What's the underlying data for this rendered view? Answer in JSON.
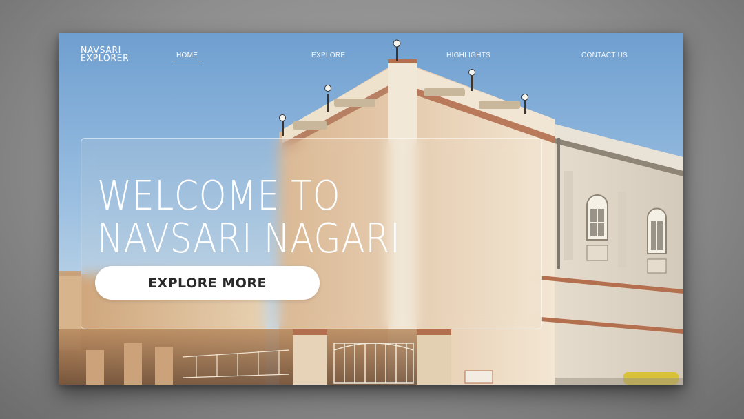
{
  "brand": {
    "line1": "NAVSARI",
    "line2": "EXPLORER"
  },
  "nav": {
    "items": [
      {
        "label": "HOME",
        "active": true
      },
      {
        "label": "EXPLORE",
        "active": false
      },
      {
        "label": "HIGHLIGHTS",
        "active": false
      },
      {
        "label": "CONTACT US",
        "active": false
      }
    ]
  },
  "hero": {
    "headline_line1": "WELCOME TO",
    "headline_line2": "NAVSARI NAGARI",
    "cta_label": "EXPLORE MORE"
  },
  "colors": {
    "sky_top": "#6f9fd0",
    "sky_bottom": "#c9dceb",
    "building_cream": "#efe4d2",
    "building_trim": "#b36f4e",
    "button_bg": "#ffffff",
    "button_text": "#2a2a2a"
  }
}
